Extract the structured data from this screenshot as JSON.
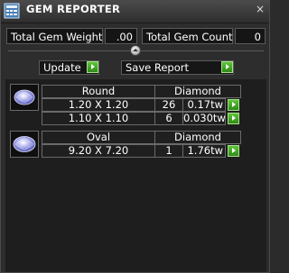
{
  "window": {
    "title": "GEM REPORTER",
    "close_glyph": "×"
  },
  "totals": {
    "weight_label": "Total Gem Weight",
    "weight_value": ".00",
    "count_label": "Total Gem Count",
    "count_value": "0"
  },
  "actions": {
    "update_label": "Update",
    "save_label": "Save Report"
  },
  "groups": [
    {
      "shape": "Round",
      "material": "Diamond",
      "icon": "round-diamond-icon",
      "rows": [
        {
          "size": "1.20 X 1.20",
          "count": "26",
          "weight": "0.17tw"
        },
        {
          "size": "1.10 X 1.10",
          "count": "6",
          "weight": "0.030tw"
        }
      ]
    },
    {
      "shape": "Oval",
      "material": "Diamond",
      "icon": "oval-diamond-icon",
      "rows": [
        {
          "size": "9.20 X 7.20",
          "count": "1",
          "weight": "1.76tw"
        }
      ]
    }
  ],
  "colors": {
    "accent_green": "#3aa020",
    "panel_background": "#2d2d2d"
  }
}
